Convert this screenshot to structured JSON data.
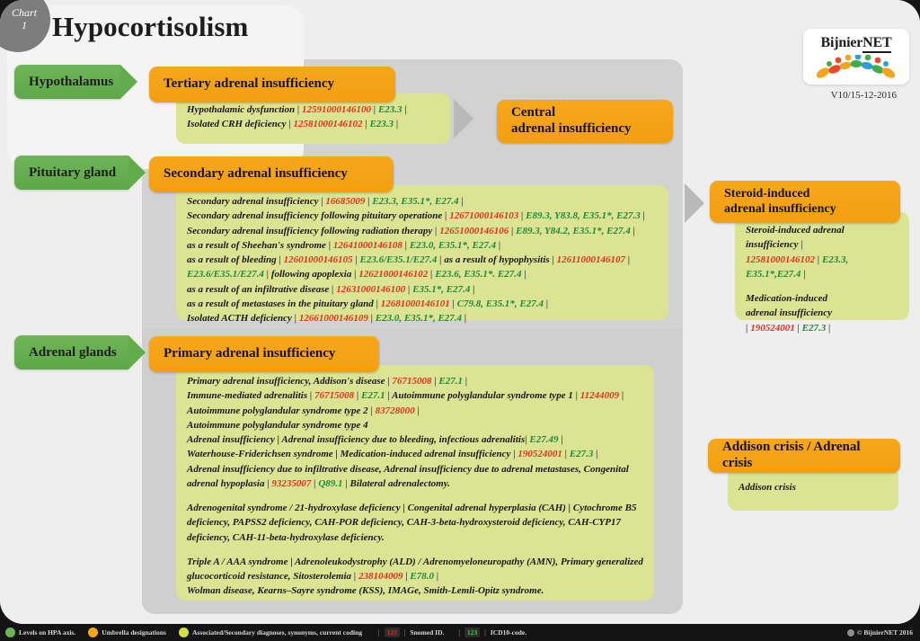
{
  "badge": {
    "label": "Chart",
    "number": "1"
  },
  "title": "Hypocortisolism",
  "logo": {
    "name_part1": "Bijnier",
    "name_part2": "NET",
    "version": "V10/15-12-2016"
  },
  "left_labels": {
    "hypothalamus": "Hypothalamus",
    "pituitary": "Pituitary gland",
    "adrenal": "Adrenal glands"
  },
  "headers": {
    "tertiary": "Tertiary adrenal insufficiency",
    "secondary": "Secondary adrenal insufficiency",
    "primary": "Primary adrenal insufficiency",
    "central_line1": "Central",
    "central_line2": "adrenal insufficiency",
    "steroid_line1": "Steroid-induced",
    "steroid_line2": "adrenal insufficiency",
    "addison": "Addison crisis / Adrenal crisis"
  },
  "tertiary_lines": [
    {
      "name": "Hypothalamic dysfunction",
      "snomed": "12591000146100",
      "icd": "E23.3"
    },
    {
      "name": "Isolated CRH deficiency",
      "snomed": "12581000146102",
      "icd": "E23.3"
    }
  ],
  "secondary_lines": [
    {
      "name": "Secondary adrenal insufficiency",
      "snomed": "16685009",
      "icd": "E23.3, E35.1*, E27.4"
    },
    {
      "name": "Secondary adrenal insufficiency following pituitary operatione",
      "snomed": "12671000146103",
      "icd": "E89.3, Y83.8, E35.1*, E27.3"
    },
    {
      "name": "Secondary adrenal insufficiency following radiation therapy",
      "snomed": "12651000146106",
      "icd": "E89.3, Y84.2, E35.1*, E27.4"
    },
    {
      "name": "as a result of Sheehan's syndrome",
      "snomed": "12641000146108",
      "icd": "E23.0, E35.1*, E27.4"
    },
    {
      "name": "as a result of bleeding",
      "snomed": "12601000146105",
      "icd": "E23.6/E35.1/E27.4"
    },
    {
      "name": "as a result of hypophysitis",
      "snomed": "12611000146107",
      "icd": "E23.6/E35.1/E27.4"
    },
    {
      "name": "following apoplexia",
      "snomed": "12621000146102",
      "icd": "E23.6, E35.1*. E27.4"
    },
    {
      "name": "as a result of an infiltrative disease",
      "snomed": "12631000146100",
      "icd": "E35.1*, E27.4"
    },
    {
      "name": "as a result of metastases in the pituitary gland",
      "snomed": "12681000146101",
      "icd": "C79.8, E35.1*, E27.4"
    },
    {
      "name": "Isolated ACTH deficiency",
      "snomed": "12661000146109",
      "icd": "E23.0, E35.1*, E27.4"
    }
  ],
  "primary_block1": {
    "l1_name": "Primary adrenal insufficiency, Addison's disease",
    "l1_sn": "76715008",
    "l1_icd": "E27.1",
    "l2_name": "Immune-mediated adrenalitis",
    "l2_sn": "76715008",
    "l2_icd": "E27.1",
    "l2_name2": "Autoimmune polyglandular syndrome type 1",
    "l2_sn2": "11244009",
    "l3_name": "Autoimmune polyglandular syndrome type 2",
    "l3_sn": "83728000",
    "l4_name": "Autoimmune polyglandular syndrome type 4",
    "l5_name": "Adrenal insufficiency | Adrenal insufficiency due to bleeding, infectious adrenalitis",
    "l5_icd": "E27.49",
    "l6_name": "Waterhouse-Friderichsen syndrome | Medication-induced adrenal insufficiency",
    "l6_sn": "190524001",
    "l6_icd": "E27.3",
    "l7_name": "Adrenal insufficiency due to infiltrative disease, Adrenal insufficiency due to adrenal metastases, Congenital",
    "l7_name2": "adrenal hypoplasia",
    "l7_sn": "93235007",
    "l7_icd": "Q89.1",
    "l7_tail": "Bilateral adrenalectomy."
  },
  "primary_block2": [
    "Adrenogenital syndrome / 21-hydroxylase deficiency | Congenital adrenal hyperplasia (CAH) | Cytochrome B5",
    "deficiency, PAPSS2 deficiency, CAH-POR deficiency, CAH-3-beta-hydroxysteroid deficiency, CAH-CYP17",
    "deficiency, CAH-11-beta-hydroxylase deficiency."
  ],
  "primary_block3": {
    "l1": "Triple A / AAA syndrome | Adrenoleukodystrophy (ALD) / Adrenomyeloneuropathy (AMN), Primary generalized",
    "l2_name": "glucocorticoid resistance, Sitosterolemia",
    "l2_sn": "238104009",
    "l2_icd": "E78.0",
    "l3": "Wolman disease, Kearns–Sayre syndrome (KSS), IMAGe, Smith-Lemli-Opitz syndrome."
  },
  "steroid_box": {
    "l1_name": "Steroid-induced adrenal insufficiency",
    "l1_sn": "12581000146102",
    "l1_icd": "E23.3, E35.1*,E27.4",
    "l2_name1": "Medication-induced",
    "l2_name2": "adrenal insufficiency",
    "l2_sn": "190524001",
    "l2_icd": "E27.3"
  },
  "addison_box": {
    "text": "Addison crisis"
  },
  "footer": {
    "legend": [
      {
        "color": "#6fb558",
        "label": "Levels on HPA axis."
      },
      {
        "color": "#f7a71c",
        "label": "Umbrella designations"
      },
      {
        "color": "#d3e03f",
        "label": "Associated/Secondary diagnoses, synonyms, current coding"
      }
    ],
    "snomed_chip": "123",
    "snomed_label": "Snomed ID.",
    "icd_chip": "123",
    "icd_label": "ICD10-code.",
    "copyright": "© BijnierNET 2016",
    "snomed_color": "#e03321",
    "icd_color": "#46c24a"
  }
}
